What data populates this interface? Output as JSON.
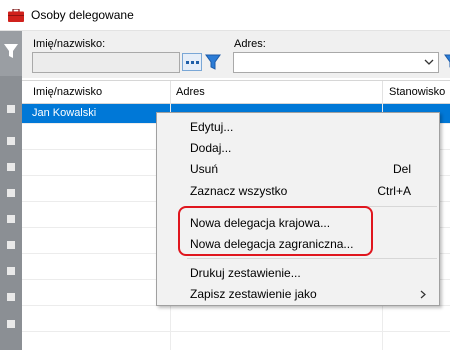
{
  "window": {
    "title": "Osoby delegowane"
  },
  "filters": {
    "name_label": "Imię/nazwisko:",
    "name_value": "",
    "address_label": "Adres:",
    "address_value": ""
  },
  "grid": {
    "columns": [
      "Imię/nazwisko",
      "Adres",
      "Stanowisko"
    ],
    "rows": [
      {
        "name": "Jan Kowalski",
        "address": "",
        "position": ""
      }
    ],
    "selected_color": "#0078d7"
  },
  "context_menu": {
    "items": [
      {
        "label": "Edytuj...",
        "shortcut": ""
      },
      {
        "label": "Dodaj...",
        "shortcut": ""
      },
      {
        "label": "Usuń",
        "shortcut": "Del"
      },
      {
        "label": "Zaznacz wszystko",
        "shortcut": "Ctrl+A"
      },
      {
        "label": "Nowa delegacja krajowa...",
        "shortcut": ""
      },
      {
        "label": "Nowa delegacja zagraniczna...",
        "shortcut": ""
      },
      {
        "label": "Drukuj zestawienie...",
        "shortcut": ""
      },
      {
        "label": "Zapisz zestawienie jako",
        "shortcut": "",
        "submenu": true
      }
    ],
    "highlight_color": "#e0161e"
  },
  "icons": {
    "app": "briefcase-icon",
    "filter": "funnel-icon",
    "lookup": "ellipsis-icon",
    "combo": "chevron-down-icon",
    "submenu": "chevron-right-icon"
  }
}
